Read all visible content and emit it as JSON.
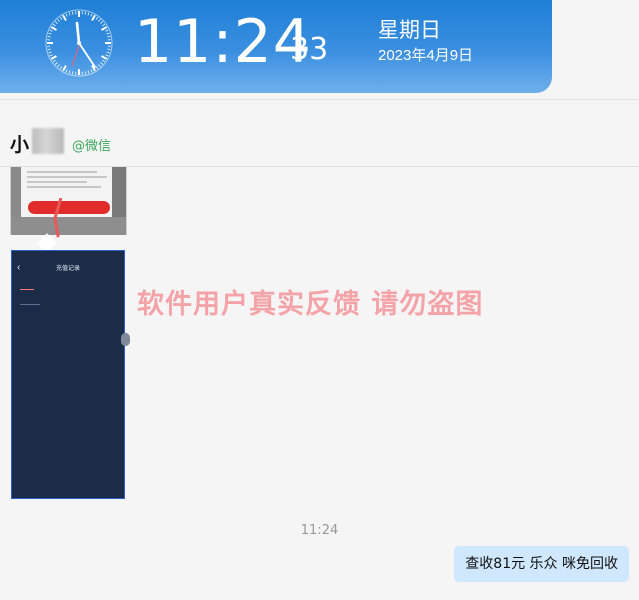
{
  "clock": {
    "time": "11:24",
    "seconds": "33",
    "weekday": "星期日",
    "date": "2023年4月9日"
  },
  "contact": {
    "name_visible": "小",
    "source_tag": "@微信"
  },
  "image_dark": {
    "title": "充值记录"
  },
  "watermark": "软件用户真实反馈  请勿盗图",
  "chat": {
    "timestamp": "11:24",
    "outgoing_message": "查收81元  乐众 咪免回收"
  },
  "colors": {
    "banner": "#3b8fe0",
    "bubble": "#cfe8fd",
    "watermark": "#f4a3a8",
    "wechat_green": "#3aa859"
  }
}
